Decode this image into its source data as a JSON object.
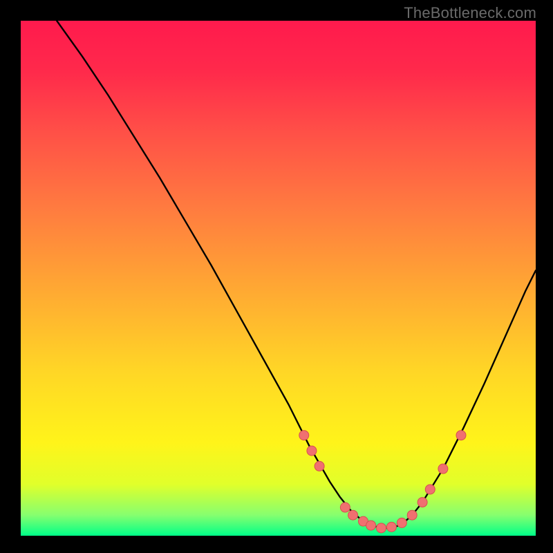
{
  "attribution": "TheBottleneck.com",
  "chart_data": {
    "type": "line",
    "title": "",
    "xlabel": "",
    "ylabel": "",
    "xlim": [
      0,
      100
    ],
    "ylim": [
      0,
      100
    ],
    "grid": false,
    "legend": false,
    "series": [
      {
        "name": "curve",
        "x": [
          7,
          12,
          17,
          22,
          27,
          32,
          37,
          42,
          47,
          52,
          56,
          58,
          60,
          62,
          64,
          66,
          68,
          70,
          72,
          74,
          76,
          78,
          82,
          86,
          90,
          94,
          98,
          100
        ],
        "y": [
          100,
          93,
          85.5,
          77.5,
          69.5,
          61,
          52.5,
          43.5,
          34.5,
          25.5,
          17.5,
          14,
          10.5,
          7.5,
          5,
          3.2,
          2,
          1.5,
          1.5,
          2.2,
          4,
          6.5,
          13,
          21,
          29.5,
          38.5,
          47.5,
          51.5
        ],
        "color": "#000000"
      }
    ],
    "markers": [
      {
        "x": 55,
        "y": 19.5
      },
      {
        "x": 56.5,
        "y": 16.5
      },
      {
        "x": 58,
        "y": 13.5
      },
      {
        "x": 63,
        "y": 5.5
      },
      {
        "x": 64.5,
        "y": 4
      },
      {
        "x": 66.5,
        "y": 2.8
      },
      {
        "x": 68,
        "y": 2
      },
      {
        "x": 70,
        "y": 1.5
      },
      {
        "x": 72,
        "y": 1.7
      },
      {
        "x": 74,
        "y": 2.5
      },
      {
        "x": 76,
        "y": 4
      },
      {
        "x": 78,
        "y": 6.5
      },
      {
        "x": 79.5,
        "y": 9
      },
      {
        "x": 82,
        "y": 13
      },
      {
        "x": 85.5,
        "y": 19.5
      }
    ],
    "marker_style": {
      "fill": "#f07070",
      "stroke": "#d65050",
      "radius_px": 7
    },
    "background": {
      "type": "vertical-gradient",
      "stops": [
        {
          "pos": 0,
          "color": "#ff1a4d"
        },
        {
          "pos": 100,
          "color": "#00ff88"
        }
      ]
    }
  }
}
